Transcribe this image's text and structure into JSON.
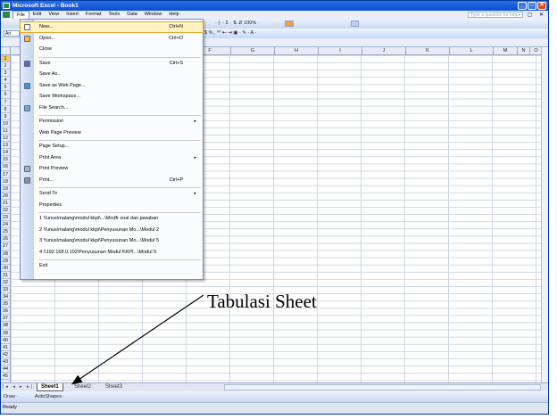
{
  "window": {
    "title": "Microsoft Excel - Book1",
    "controls": {
      "minimize": "_",
      "maximize": "□",
      "close": "✕"
    }
  },
  "menubar": {
    "items": [
      "File",
      "Edit",
      "View",
      "Insert",
      "Format",
      "Tools",
      "Data",
      "Window",
      "Help"
    ],
    "help_placeholder": "Type a question for help",
    "doc_controls": "- ▢ ✕"
  },
  "toolbar": {
    "font_box": "Ari",
    "standard_text": "· (· ∙  Σ · ⇅  ⇵  100% · ",
    "format_text": "$ % , ⁰⁰  ⇤ ⇥  ▣ · ✎ · A ·"
  },
  "grid": {
    "columns": [
      "F",
      "G",
      "H",
      "I",
      "J",
      "K",
      "L",
      "M",
      "N",
      "O"
    ],
    "rows": [
      "1",
      "2",
      "3",
      "4",
      "5",
      "6",
      "7",
      "8",
      "9",
      "10",
      "11",
      "12",
      "13",
      "14",
      "15",
      "16",
      "17",
      "18",
      "19",
      "20",
      "21",
      "22",
      "23",
      "24",
      "25",
      "26",
      "27",
      "28",
      "29",
      "30",
      "31",
      "32",
      "33",
      "34",
      "35",
      "36",
      "37",
      "38",
      "39",
      "40",
      "41",
      "42",
      "43",
      "44",
      "45"
    ],
    "selected_row": "1"
  },
  "file_menu": {
    "items": [
      {
        "label": "New...",
        "shortcut": "Ctrl+N",
        "highlighted": true,
        "icon": "new-icon"
      },
      {
        "label": "Open...",
        "shortcut": "Ctrl+O",
        "icon": "open-icon"
      },
      {
        "label": "Close"
      },
      {
        "label": "Save",
        "shortcut": "Ctrl+S",
        "icon": "save-icon"
      },
      {
        "label": "Save As..."
      },
      {
        "label": "Save as Web Page...",
        "icon": "web-icon"
      },
      {
        "label": "Save Workspace..."
      },
      {
        "label": "File Search...",
        "icon": "search-icon"
      },
      {
        "label": "Permission",
        "submenu": true
      },
      {
        "label": "Web Page Preview"
      },
      {
        "label": "Page Setup..."
      },
      {
        "label": "Print Area",
        "submenu": true
      },
      {
        "label": "Print Preview",
        "icon": "preview-icon"
      },
      {
        "label": "Print...",
        "shortcut": "Ctrl+P",
        "icon": "print-icon"
      },
      {
        "label": "Send To",
        "submenu": true
      },
      {
        "label": "Properties"
      },
      {
        "label": "1 Yunus\\malang\\modul kkpi\\...\\Modfr soal dan jawaban"
      },
      {
        "label": "2 Yunus\\malang\\modul kkpi\\Penyusunan Mo...\\Modul 2"
      },
      {
        "label": "3 Yunus\\malang\\modul kkpi\\Penyusunan Mo...\\Modul 5"
      },
      {
        "label": "4 \\\\192.168.0.102\\Penyusunan Modul KKPI...\\Modul 5"
      },
      {
        "label": "Exit"
      }
    ]
  },
  "sheet_tabs": {
    "nav": "|◂ ◂ ▸ ▸|",
    "tabs": [
      "Sheet1",
      "Sheet2",
      "Sheet3"
    ],
    "active": "Sheet1"
  },
  "drawing_toolbar": {
    "draw_label": "Draw ·",
    "autoshapes_label": "AutoShapes ·"
  },
  "status": {
    "text": "Ready"
  },
  "annotation": {
    "text": "Tabulasi Sheet"
  }
}
